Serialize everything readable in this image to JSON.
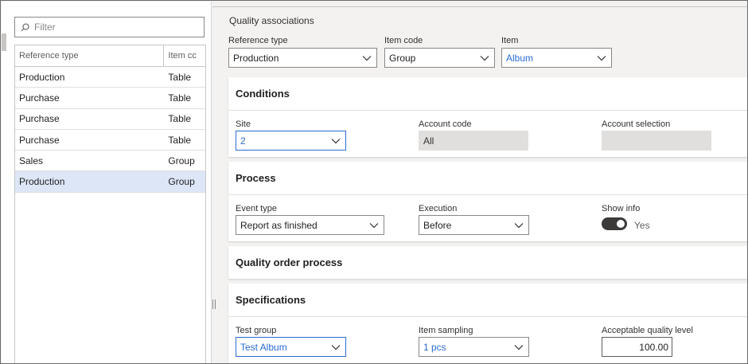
{
  "left_pane": {
    "filter": {
      "placeholder": "Filter",
      "value": ""
    },
    "grid": {
      "columns": [
        "Reference type",
        "Item cc"
      ],
      "rows": [
        {
          "reference_type": "Production",
          "item_code": "Table",
          "selected": false
        },
        {
          "reference_type": "Purchase",
          "item_code": "Table",
          "selected": false
        },
        {
          "reference_type": "Purchase",
          "item_code": "Table",
          "selected": false
        },
        {
          "reference_type": "Purchase",
          "item_code": "Table",
          "selected": false
        },
        {
          "reference_type": "Sales",
          "item_code": "Group",
          "selected": false
        },
        {
          "reference_type": "Production",
          "item_code": "Group",
          "selected": true
        }
      ]
    }
  },
  "header": {
    "title": "Quality associations",
    "reference_type": {
      "label": "Reference type",
      "value": "Production"
    },
    "item_code": {
      "label": "Item code",
      "value": "Group"
    },
    "item": {
      "label": "Item",
      "value": "Album"
    }
  },
  "conditions": {
    "title": "Conditions",
    "site": {
      "label": "Site",
      "value": "2"
    },
    "account_code": {
      "label": "Account code",
      "value": "All"
    },
    "account_selection": {
      "label": "Account selection",
      "value": ""
    }
  },
  "process": {
    "title": "Process",
    "event_type": {
      "label": "Event type",
      "value": "Report as finished"
    },
    "execution": {
      "label": "Execution",
      "value": "Before"
    },
    "show_info": {
      "label": "Show info",
      "value": "Yes",
      "on": true
    }
  },
  "quality_order_process": {
    "title": "Quality order process"
  },
  "specifications": {
    "title": "Specifications",
    "test_group": {
      "label": "Test group",
      "value": "Test Album"
    },
    "item_sampling": {
      "label": "Item sampling",
      "value": "1 pcs"
    },
    "acceptable_quality_level": {
      "label": "Acceptable quality level",
      "value": "100.00"
    }
  },
  "colors": {
    "accent": "#2b6cd4",
    "selected_row": "#dce6f7",
    "toggle_on": "#3b3a39"
  }
}
